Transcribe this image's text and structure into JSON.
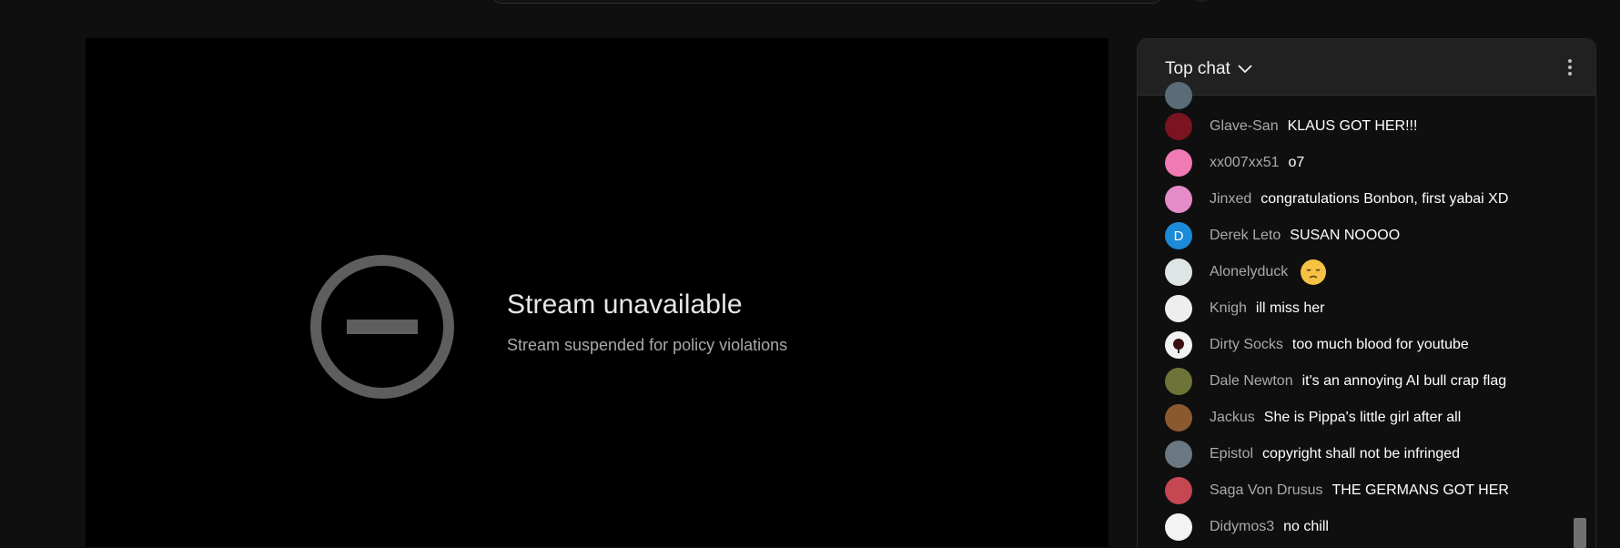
{
  "player": {
    "title": "Stream unavailable",
    "subtitle": "Stream suspended for policy violations"
  },
  "chat": {
    "mode_label": "Top chat",
    "messages": [
      {
        "author": "Glave-San",
        "text": "KLAUS GOT HER!!!",
        "avatar_color": "#7a1420",
        "avatar_icon": "anime-avatar"
      },
      {
        "author": "xx007xx51",
        "text": "o7",
        "avatar_color": "#f07ab3",
        "avatar_icon": "anime-avatar"
      },
      {
        "author": "Jinxed",
        "text": "congratulations Bonbon, first yabai XD",
        "avatar_color": "#e58bc7",
        "avatar_icon": "anime-avatar"
      },
      {
        "author": "Derek Leto",
        "text": "SUSAN NOOOO",
        "avatar_color": "#1d8ad7",
        "avatar_letter": "D"
      },
      {
        "author": "Alonelyduck",
        "text": "",
        "avatar_color": "#dfe5e5",
        "avatar_icon": "anime-avatar",
        "emoji": "pensive-face-emoji"
      },
      {
        "author": "Knigh",
        "text": "ill miss her",
        "avatar_color": "#eeeeee",
        "avatar_icon": "sketch-avatar"
      },
      {
        "author": "Dirty Socks",
        "text": "too much blood for youtube",
        "avatar_color": "#f2f2f2",
        "avatar_icon": "rose-avatar"
      },
      {
        "author": "Dale Newton",
        "text": "it's an annoying AI bull crap flag",
        "avatar_color": "#6e7338",
        "avatar_icon": "photo-avatar"
      },
      {
        "author": "Jackus",
        "text": "She is Pippa's little girl after all",
        "avatar_color": "#8a5a2e",
        "avatar_icon": "photo-avatar"
      },
      {
        "author": "Epistol",
        "text": "copyright shall not be infringed",
        "avatar_color": "#6a7882",
        "avatar_icon": "photo-avatar"
      },
      {
        "author": "Saga Von Drusus",
        "text": "THE GERMANS GOT HER",
        "avatar_color": "#c44752",
        "avatar_icon": "anime-avatar"
      },
      {
        "author": "Didymos3",
        "text": "no chill",
        "avatar_color": "#f3f3f3",
        "avatar_icon": "anime-avatar"
      }
    ]
  },
  "colors": {
    "background": "#0f0f0f",
    "player_background": "#000000",
    "chat_header": "#212121",
    "author_text": "#aaaaaa",
    "message_text": "#ffffff",
    "unavailable_icon": "#5e5e5e"
  },
  "icons": {
    "unavailable": "no-entry-icon",
    "mode_dropdown": "chevron-down-icon",
    "more_options": "more-vert-icon"
  }
}
